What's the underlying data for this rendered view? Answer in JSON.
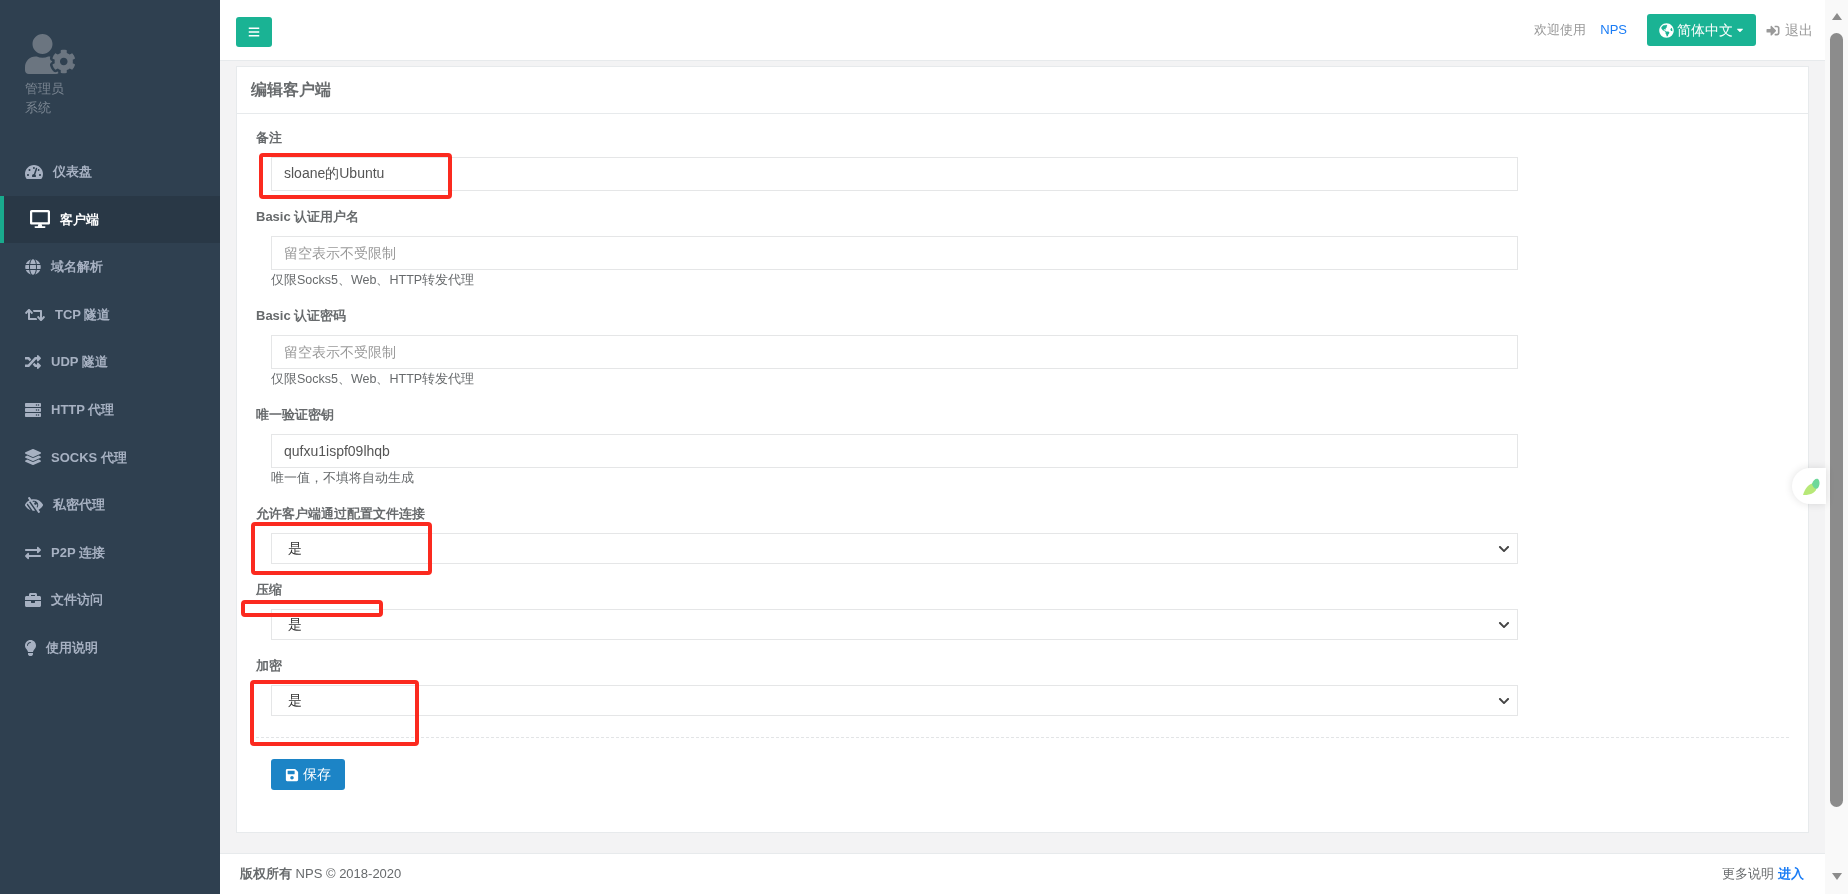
{
  "sidebar": {
    "user": {
      "name": "管理员",
      "role": "系统"
    },
    "items": [
      {
        "label": "仪表盘",
        "selected": false
      },
      {
        "label": "客户端",
        "selected": true
      },
      {
        "label": "域名解析",
        "selected": false
      },
      {
        "label": "TCP 隧道",
        "selected": false
      },
      {
        "label": "UDP 隧道",
        "selected": false
      },
      {
        "label": "HTTP 代理",
        "selected": false
      },
      {
        "label": "SOCKS 代理",
        "selected": false
      },
      {
        "label": "私密代理",
        "selected": false
      },
      {
        "label": "P2P 连接",
        "selected": false
      },
      {
        "label": "文件访问",
        "selected": false
      },
      {
        "label": "使用说明",
        "selected": false
      }
    ]
  },
  "topbar": {
    "welcome": "欢迎使用",
    "brand": "NPS",
    "language": "简体中文",
    "logout": "退出"
  },
  "card": {
    "title": "编辑客户端",
    "fields": [
      {
        "kind": "input",
        "label": "备注",
        "value": "sloane的Ubuntu",
        "annotated": true
      },
      {
        "kind": "input",
        "label": "Basic 认证用户名",
        "placeholder": "留空表示不受限制",
        "help": "仅限Socks5、Web、HTTP转发代理",
        "annotated": false
      },
      {
        "kind": "input",
        "label": "Basic 认证密码",
        "placeholder": "留空表示不受限制",
        "help": "仅限Socks5、Web、HTTP转发代理",
        "annotated": false
      },
      {
        "kind": "input",
        "label": "唯一验证密钥",
        "value": "qufxu1ispf09lhqb",
        "help": "唯一值，不填将自动生成",
        "annotated": false
      },
      {
        "kind": "select",
        "label": "允许客户端通过配置文件连接",
        "value": "是",
        "annotated": true
      },
      {
        "kind": "select",
        "label": "压缩",
        "value": "是",
        "annotated": true
      },
      {
        "kind": "select",
        "label": "加密",
        "value": "是",
        "annotated": true
      }
    ],
    "save_button": "保存"
  },
  "footer": {
    "copyright": "**版权所有** NPS © 2018-2020",
    "more": "更多说明",
    "link": "进入"
  }
}
